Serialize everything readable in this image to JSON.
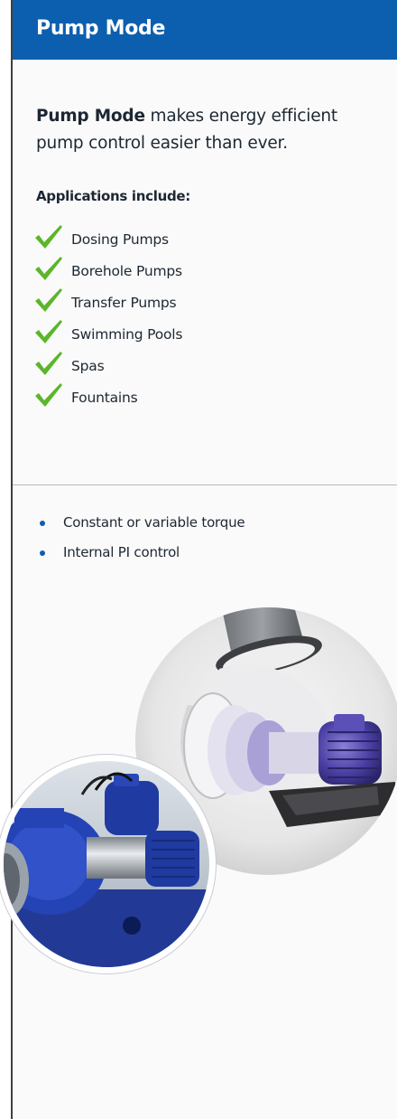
{
  "header": {
    "title": "Pump Mode"
  },
  "intro": {
    "bold": "Pump Mode",
    "rest": " makes energy efficient pump control easier than ever."
  },
  "applications": {
    "heading": "Applications include:",
    "items": [
      "Dosing Pumps",
      "Borehole Pumps",
      "Transfer Pumps",
      "Swimming Pools",
      "Spas",
      "Fountains"
    ]
  },
  "features": [
    "Constant or variable torque",
    "Internal PI control"
  ],
  "images": {
    "large": "pump-cutaway-photo",
    "small": "blue-pump-installation-photo"
  },
  "colors": {
    "brand_blue": "#0c5fae",
    "check_green": "#5bb62a",
    "text": "#1d2733"
  }
}
